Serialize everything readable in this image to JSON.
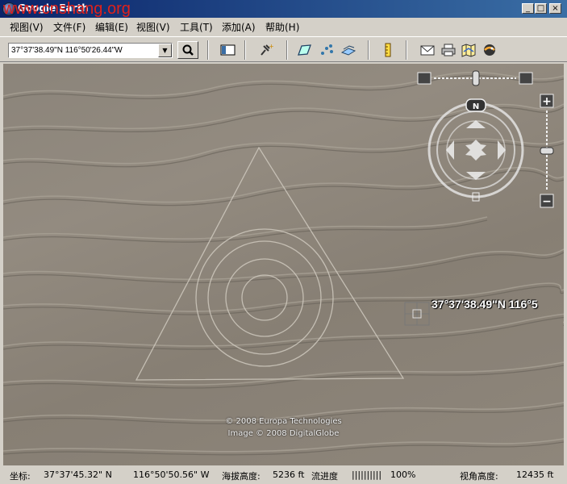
{
  "window": {
    "title": "Google Earth",
    "watermark": "www.cnshang.org",
    "controls": {
      "minimize": "_",
      "maximize": "□",
      "close": "×"
    }
  },
  "menu": {
    "items": [
      "视图(V)",
      "文件(F)",
      "编辑(E)",
      "视图(V)",
      "工具(T)",
      "添加(A)",
      "帮助(H)"
    ]
  },
  "toolbar": {
    "search_value": "37°37'38.49\"N 116°50'26.44\"W",
    "icons": [
      "sidebar-toggle-icon",
      "placemark-icon",
      "polygon-icon",
      "path-icon",
      "image-overlay-icon",
      "ruler-icon",
      "email-icon",
      "print-icon",
      "map-icon",
      "sky-icon"
    ]
  },
  "map": {
    "attribution_line1": "© 2008 Europa Technologies",
    "attribution_line2": "Image © 2008 DigitalGlobe",
    "placemark_label": "37°37'38.49\"N 116°5",
    "compass_north": "N",
    "zoom_in": "+",
    "zoom_out": "−"
  },
  "status": {
    "coord_label": "坐标:",
    "lat": "37°37'45.32\" N",
    "lon": "116°50'50.56\" W",
    "elev_label": "海拔高度:",
    "elev_value": "5236 ft",
    "stream_label": "流进度",
    "stream_bar": "||||||||||",
    "stream_value": "100%",
    "eye_label": "视角高度:",
    "eye_value": "12435 ft"
  },
  "colors": {
    "titlebar_start": "#0a246a",
    "titlebar_end": "#3a6ea5",
    "chrome": "#d4d0c8",
    "terrain": "#8b847a",
    "watermark": "#e0201a"
  }
}
